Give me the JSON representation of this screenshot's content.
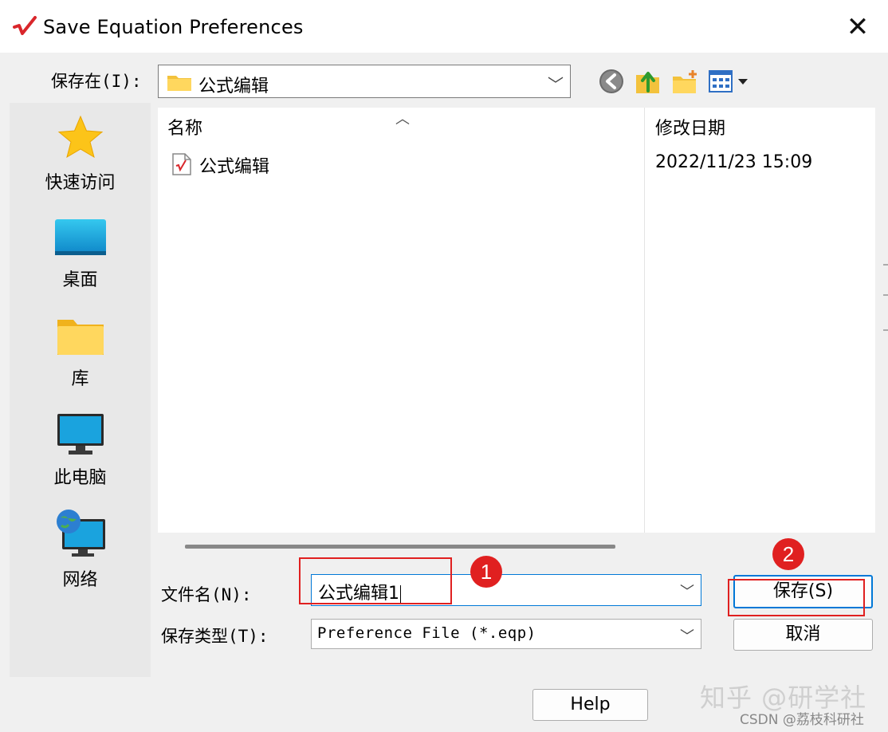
{
  "window": {
    "title": "Save Equation Preferences",
    "close_glyph": "✕"
  },
  "save_in": {
    "label": "保存在(I):",
    "value": "公式编辑"
  },
  "places": [
    {
      "label": "快速访问",
      "icon": "star-icon"
    },
    {
      "label": "桌面",
      "icon": "desktop-icon"
    },
    {
      "label": "库",
      "icon": "library-folder-icon"
    },
    {
      "label": "此电脑",
      "icon": "computer-icon"
    },
    {
      "label": "网络",
      "icon": "network-icon"
    }
  ],
  "file_list": {
    "columns": [
      "名称",
      "修改日期"
    ],
    "rows": [
      {
        "name": "公式编辑",
        "date": "2022/11/23 15:09"
      }
    ]
  },
  "file_name": {
    "label": "文件名(N):",
    "value": "公式编辑1"
  },
  "file_type": {
    "label": "保存类型(T):",
    "value": "Preference File (*.eqp)"
  },
  "buttons": {
    "save": "保存(S)",
    "cancel": "取消",
    "help": "Help"
  },
  "annotations": {
    "badge1": "1",
    "badge2": "2",
    "color": "#e02020"
  },
  "watermark": {
    "main": "知乎 @研学社",
    "sub": "CSDN @荔枝科研社"
  }
}
